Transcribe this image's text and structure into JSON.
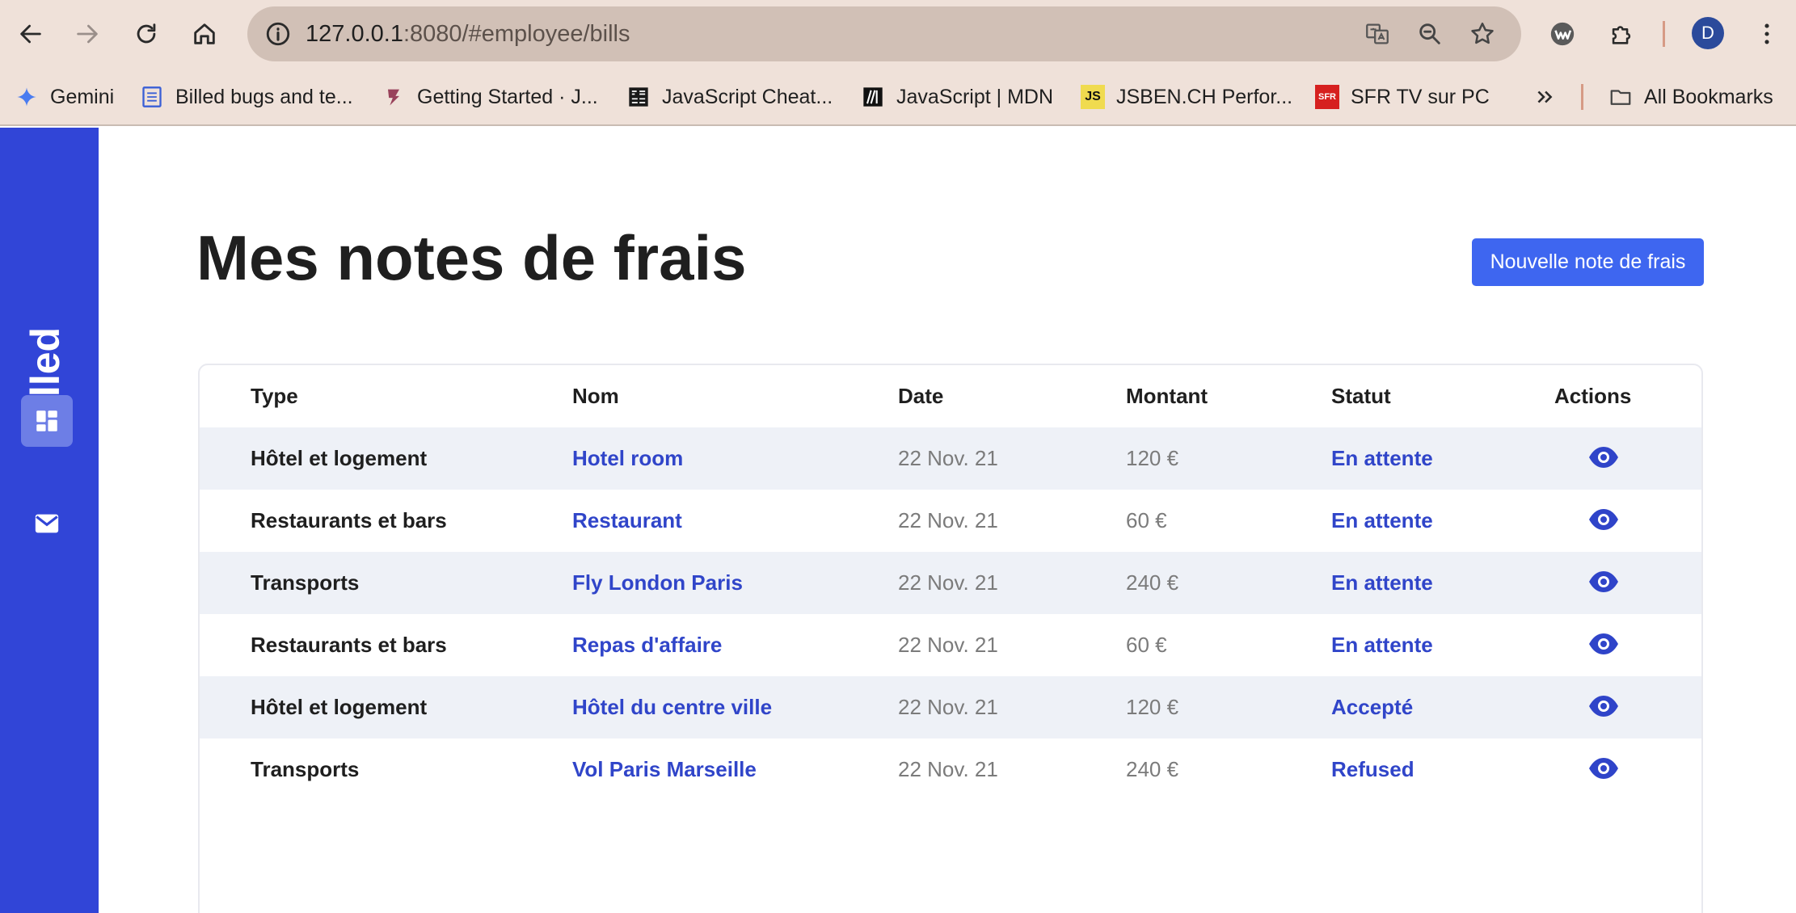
{
  "browser": {
    "url_host": "127.0.0.1",
    "url_rest": ":8080/#employee/bills",
    "profile_initial": "D",
    "bookmarks": [
      {
        "label": "Gemini",
        "icon": "gemini-icon"
      },
      {
        "label": "Billed bugs and te...",
        "icon": "doc-icon"
      },
      {
        "label": "Getting Started · J...",
        "icon": "jest-icon"
      },
      {
        "label": "JavaScript Cheat...",
        "icon": "cheatsheet-icon"
      },
      {
        "label": "JavaScript | MDN",
        "icon": "mdn-icon"
      },
      {
        "label": "JSBEN.CH Perfor...",
        "icon": "js-icon"
      },
      {
        "label": "SFR TV sur PC",
        "icon": "sfr-icon"
      }
    ],
    "all_bookmarks_label": "All Bookmarks",
    "js_badge": "JS",
    "sfr_badge": "SFR"
  },
  "app": {
    "logo": "Billed",
    "page_title": "Mes notes de frais",
    "new_button": "Nouvelle note de frais",
    "accent_color": "#3145d7"
  },
  "table": {
    "headers": {
      "type": "Type",
      "name": "Nom",
      "date": "Date",
      "amount": "Montant",
      "status": "Statut",
      "actions": "Actions"
    },
    "rows": [
      {
        "type": "Hôtel et logement",
        "name": "Hotel room",
        "date": "22 Nov. 21",
        "amount": "120 €",
        "status": "En attente"
      },
      {
        "type": "Restaurants et bars",
        "name": "Restaurant",
        "date": "22 Nov. 21",
        "amount": "60 €",
        "status": "En attente"
      },
      {
        "type": "Transports",
        "name": "Fly London Paris",
        "date": "22 Nov. 21",
        "amount": "240 €",
        "status": "En attente"
      },
      {
        "type": "Restaurants et bars",
        "name": "Repas d'affaire",
        "date": "22 Nov. 21",
        "amount": "60 €",
        "status": "En attente"
      },
      {
        "type": "Hôtel et logement",
        "name": "Hôtel du centre ville",
        "date": "22 Nov. 21",
        "amount": "120 €",
        "status": "Accepté"
      },
      {
        "type": "Transports",
        "name": "Vol Paris Marseille",
        "date": "22 Nov. 21",
        "amount": "240 €",
        "status": "Refused"
      }
    ]
  }
}
